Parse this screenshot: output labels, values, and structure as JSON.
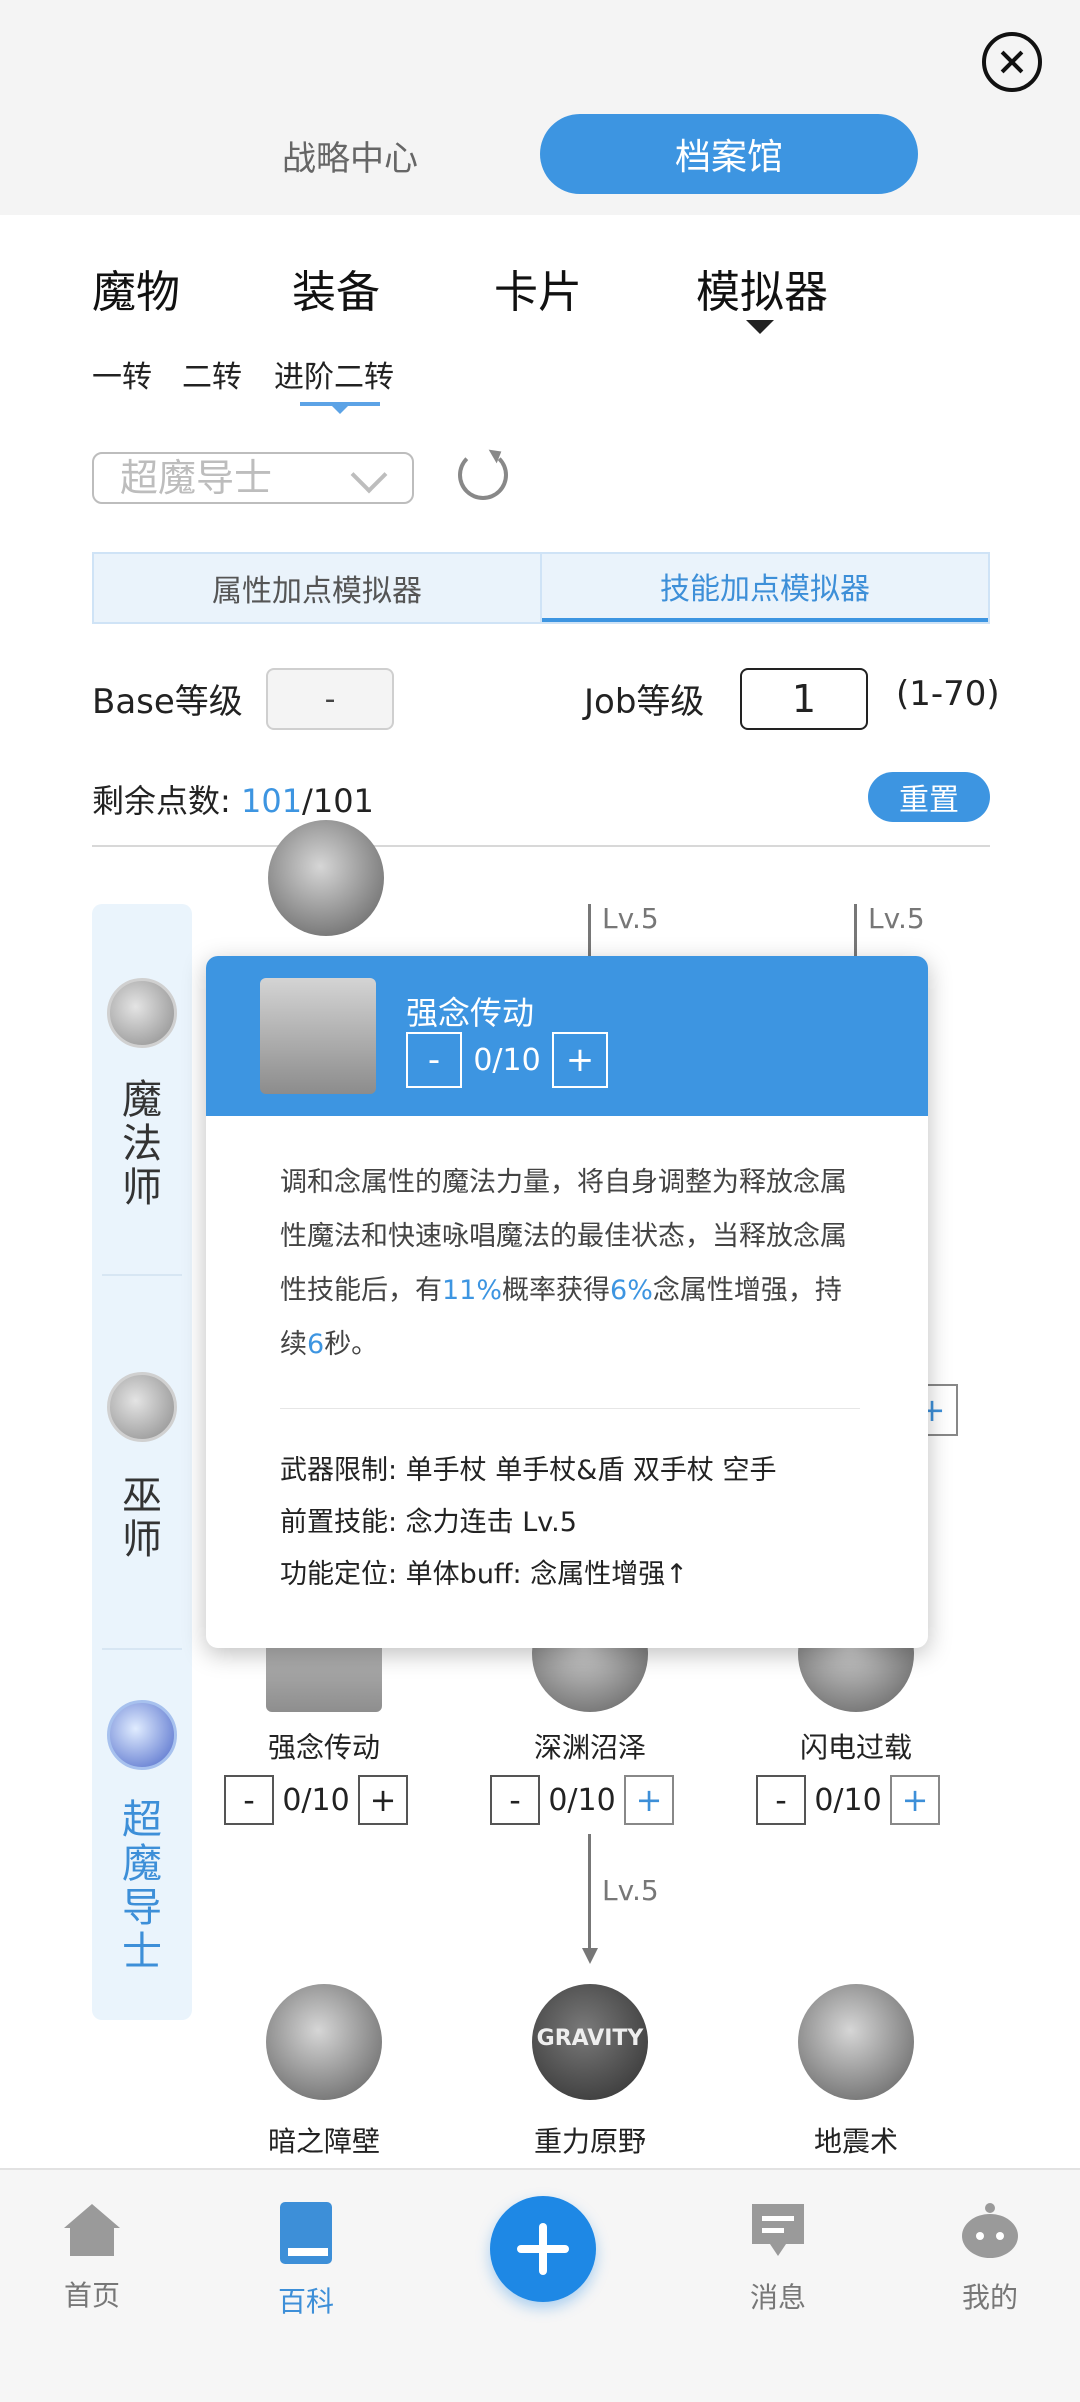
{
  "header": {
    "close_icon": "close-icon",
    "tabs": [
      {
        "label": "战略中心",
        "active": false
      },
      {
        "label": "档案馆",
        "active": true
      }
    ]
  },
  "categories": [
    "魔物",
    "装备",
    "卡片",
    "模拟器"
  ],
  "job_subtabs": [
    "一转",
    "二转",
    "进阶二转"
  ],
  "job_select": {
    "value": "超魔导士"
  },
  "sim_tabs": [
    "属性加点模拟器",
    "技能加点模拟器"
  ],
  "levels": {
    "base_label": "Base等级",
    "base_value": "-",
    "job_label": "Job等级",
    "job_value": "1",
    "job_range": "(1-70)"
  },
  "points": {
    "label": "剩余点数:",
    "remaining": "101",
    "total": "/101",
    "reset_label": "重置"
  },
  "sidebar": [
    {
      "name": "魔法师",
      "active": false
    },
    {
      "name": "巫师",
      "active": false
    },
    {
      "name": "超魔导士",
      "active": true
    }
  ],
  "tree": {
    "lv_labels": [
      "Lv.5",
      "Lv.5",
      "Lv.5"
    ],
    "row_skills": [
      {
        "name": "强念传动",
        "value": "0/10"
      },
      {
        "name": "深渊沼泽",
        "value": "0/10"
      },
      {
        "name": "闪电过载",
        "value": "0/10"
      }
    ],
    "bottom_skills": [
      "暗之障壁",
      "重力原野",
      "地震术"
    ],
    "gravity_text": "GRAVITY"
  },
  "popup": {
    "title": "强念传动",
    "value": "0/10",
    "desc_1": "调和念属性的魔法力量，将自身调整为释放念属性魔法和快速咏唱魔法的最佳状态，当释放念属性技能后，有",
    "desc_pct1": "11%",
    "desc_2": "概率获得",
    "desc_pct2": "6%",
    "desc_3": "念属性增强，持续",
    "desc_sec": "6",
    "desc_4": "秒。",
    "weapon": "武器限制:  单手杖 单手杖&盾 双手杖 空手",
    "prereq": "前置技能:  念力连击 Lv.5",
    "role": "功能定位:  单体buff:  念属性增强↑"
  },
  "nav": [
    {
      "label": "首页",
      "icon": "home-icon",
      "active": false
    },
    {
      "label": "百科",
      "icon": "book-icon",
      "active": true
    },
    {
      "label": "",
      "icon": "plus-icon",
      "active": false
    },
    {
      "label": "消息",
      "icon": "message-icon",
      "active": false
    },
    {
      "label": "我的",
      "icon": "profile-icon",
      "active": false
    }
  ],
  "colors": {
    "accent": "#3d95e1",
    "fab": "#1e88e5"
  }
}
